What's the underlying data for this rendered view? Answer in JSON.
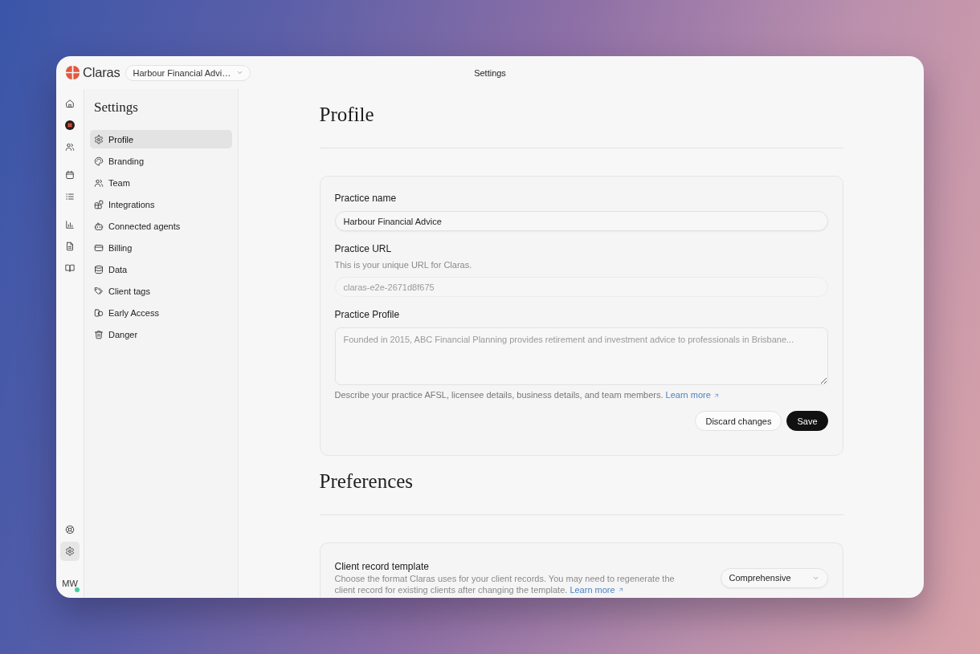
{
  "top_bar": {
    "brand": "Claras",
    "workspace": "Harbour Financial Advi…",
    "title": "Settings"
  },
  "rail": {
    "groups": [
      {
        "items": [
          {
            "selected": false
          },
          {
            "selected": false
          },
          {
            "selected": false
          }
        ]
      },
      {
        "items": [
          {
            "selected": false
          },
          {
            "selected": false
          }
        ]
      },
      {
        "items": [
          {
            "selected": false
          },
          {
            "selected": false
          },
          {
            "selected": false
          }
        ]
      }
    ],
    "bottom": [
      {
        "selected": false
      },
      {
        "selected": true
      }
    ],
    "avatar": {
      "initials": "MW",
      "online": true
    }
  },
  "sidebar": {
    "title": "Settings",
    "items": [
      {
        "label": "Profile",
        "selected": true
      },
      {
        "label": "Branding",
        "selected": false
      },
      {
        "label": "Team",
        "selected": false
      },
      {
        "label": "Integrations",
        "selected": false
      },
      {
        "label": "Connected agents",
        "selected": false
      },
      {
        "label": "Billing",
        "selected": false
      },
      {
        "label": "Data",
        "selected": false
      },
      {
        "label": "Client tags",
        "selected": false
      },
      {
        "label": "Early Access",
        "selected": false
      },
      {
        "label": "Danger",
        "selected": false
      }
    ]
  },
  "profile": {
    "heading": "Profile",
    "fields": [
      {
        "kind": "input",
        "label": "Practice name",
        "value": "Harbour Financial Advice",
        "disabled": false
      },
      {
        "kind": "input",
        "label": "Practice URL",
        "description": "This is your unique URL for Claras.",
        "value": "claras-e2e-2671d8f675",
        "disabled": true
      },
      {
        "kind": "textarea",
        "label": "Practice Profile",
        "placeholder": "Founded in 2015, ABC Financial Planning provides retirement and investment advice to professionals in Brisbane...",
        "help": "Describe your practice AFSL, licensee details, business details, and team members.",
        "link": "Learn more"
      }
    ],
    "buttons": [
      {
        "label": "Discard changes",
        "kind": "secondary"
      },
      {
        "label": "Save",
        "kind": "primary"
      }
    ]
  },
  "preferences": {
    "heading": "Preferences",
    "settings": [
      {
        "label": "Client record template",
        "description": "Choose the format Claras uses for your client records. You may need to regenerate the client record for existing clients after changing the template.",
        "link": "Learn more",
        "value": "Comprehensive"
      }
    ]
  }
}
